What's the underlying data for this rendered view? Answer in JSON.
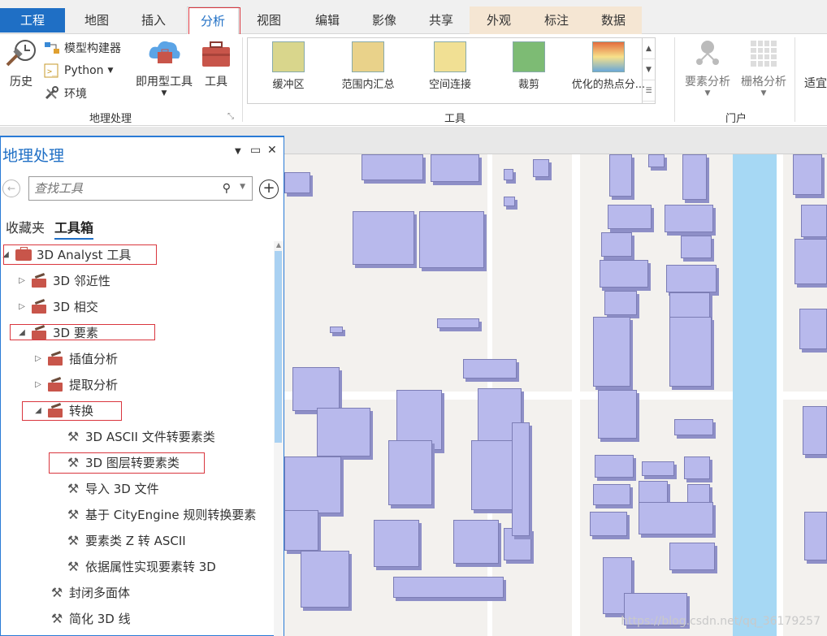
{
  "ribbon_tabs": [
    "工程",
    "地图",
    "插入",
    "分析",
    "视图",
    "编辑",
    "影像",
    "共享",
    "外观",
    "标注",
    "数据"
  ],
  "active_tab": "分析",
  "geoprocessing_group": {
    "history": "历史",
    "model_builder": "模型构建器",
    "python": "Python",
    "environments": "环境",
    "ready_to_use": "即用型工具",
    "tools": "工具",
    "label": "地理处理"
  },
  "tools_gallery": {
    "items": [
      "缓冲区",
      "范围内汇总",
      "空间连接",
      "裁剪",
      "优化的热点分..."
    ],
    "label": "工具"
  },
  "portal_group": {
    "feature_analysis": "要素分析",
    "raster_analysis": "栅格分析",
    "label": "门户"
  },
  "suitability": "适宜",
  "pane": {
    "title": "地理处理",
    "search_placeholder": "查找工具",
    "tab_favorites": "收藏夹",
    "tab_toolboxes": "工具箱"
  },
  "tree": [
    {
      "label": "3D Analyst 工具",
      "kind": "toolbox",
      "arrow": "◢"
    },
    {
      "label": "3D 邻近性",
      "kind": "toolset",
      "arrow": "▷"
    },
    {
      "label": "3D 相交",
      "kind": "toolset",
      "arrow": "▷"
    },
    {
      "label": "3D 要素",
      "kind": "toolset",
      "arrow": "◢"
    },
    {
      "label": "插值分析",
      "kind": "toolset",
      "arrow": "▷"
    },
    {
      "label": "提取分析",
      "kind": "toolset",
      "arrow": "▷"
    },
    {
      "label": "转换",
      "kind": "toolset",
      "arrow": "◢"
    },
    {
      "label": "3D ASCII 文件转要素类",
      "kind": "tool"
    },
    {
      "label": "3D 图层转要素类",
      "kind": "tool"
    },
    {
      "label": "导入 3D 文件",
      "kind": "tool"
    },
    {
      "label": "基于 CityEngine 规则转换要素",
      "kind": "tool"
    },
    {
      "label": "要素类 Z 转 ASCII",
      "kind": "tool"
    },
    {
      "label": "依据属性实现要素转 3D",
      "kind": "tool"
    },
    {
      "label": "封闭多面体",
      "kind": "tool"
    },
    {
      "label": "简化 3D 线",
      "kind": "tool"
    }
  ],
  "watermark": "https://blog.csdn.net/qq_36179257",
  "colors": {
    "accent": "#1f6fc5",
    "highlight_box": "#d9363e",
    "building": "#b8b9ec",
    "river": "#a6d8f4"
  }
}
